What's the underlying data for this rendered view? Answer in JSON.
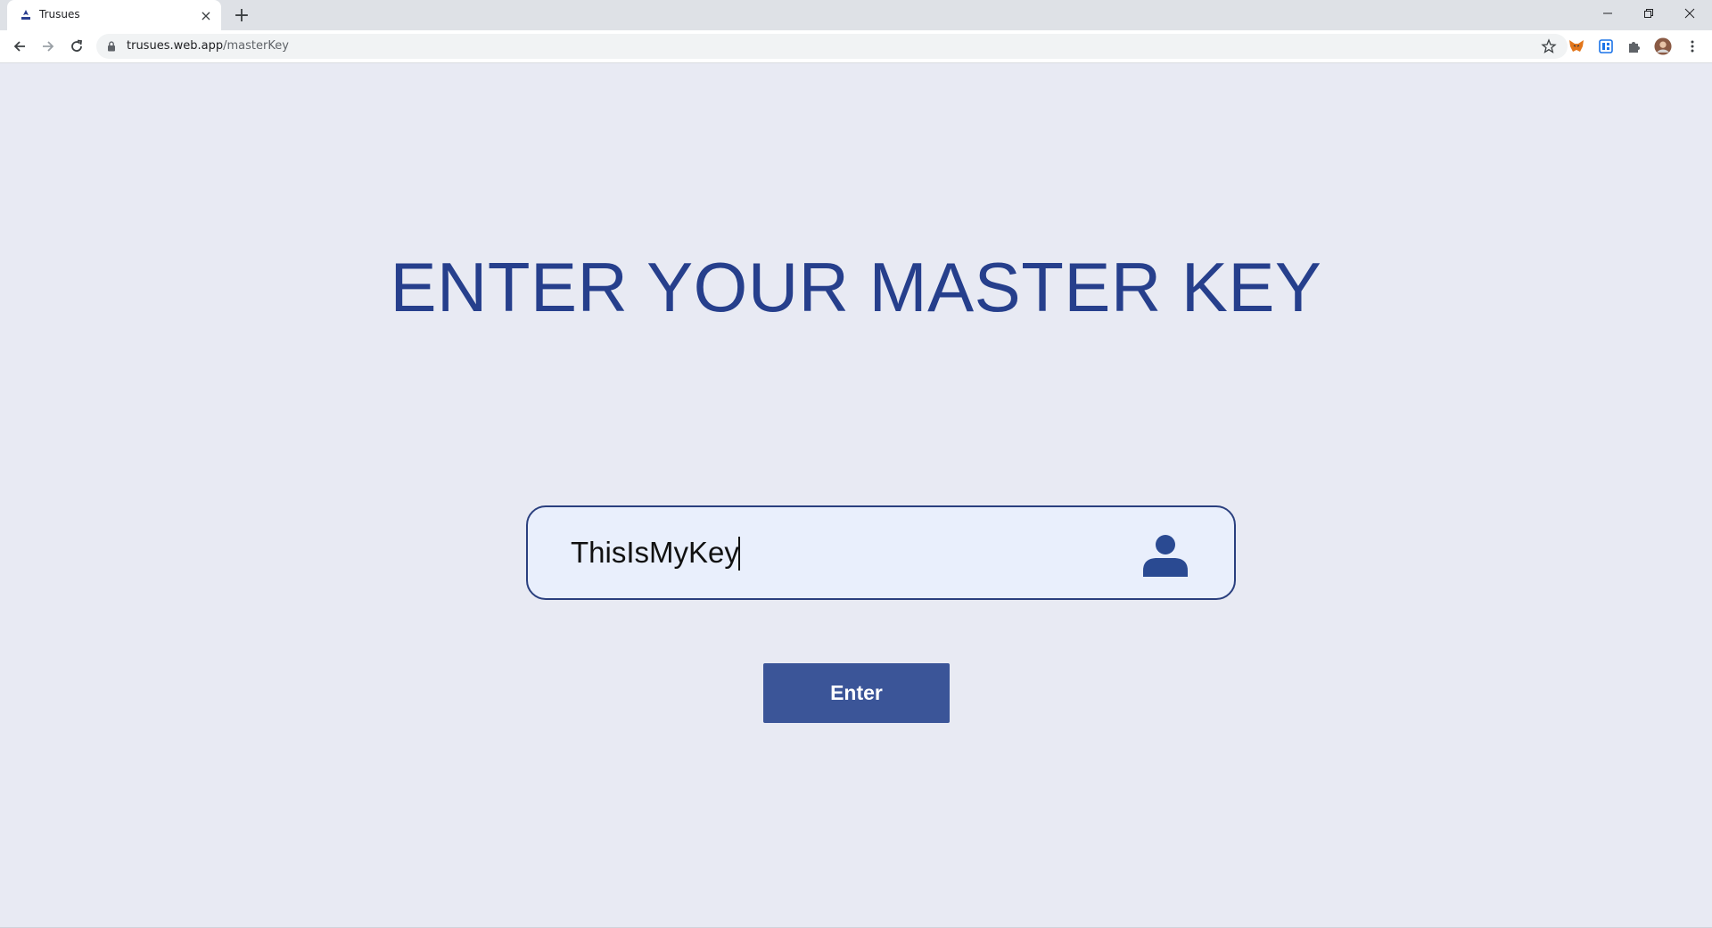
{
  "browser": {
    "tab_title": "Trusues",
    "tab_close_glyph": "×",
    "new_tab_glyph": "+",
    "url_host": "trusues.web.app",
    "url_path": "/masterKey",
    "icons": [
      "back-icon",
      "forward-icon",
      "reload-icon",
      "lock-icon",
      "star-icon",
      "metamask-icon",
      "extension-app-icon",
      "puzzle-icon",
      "profile-avatar",
      "menu-icon",
      "minimize-icon",
      "restore-icon",
      "close-icon"
    ]
  },
  "page": {
    "heading": "ENTER YOUR MASTER KEY",
    "key_input": {
      "value": "ThisIsMyKey"
    },
    "enter_button": "Enter"
  },
  "colors": {
    "background": "#e8eaf3",
    "heading": "#263f8c",
    "input_border": "#2a3f7e",
    "input_bg": "#e9effc",
    "button": "#3b5598"
  }
}
